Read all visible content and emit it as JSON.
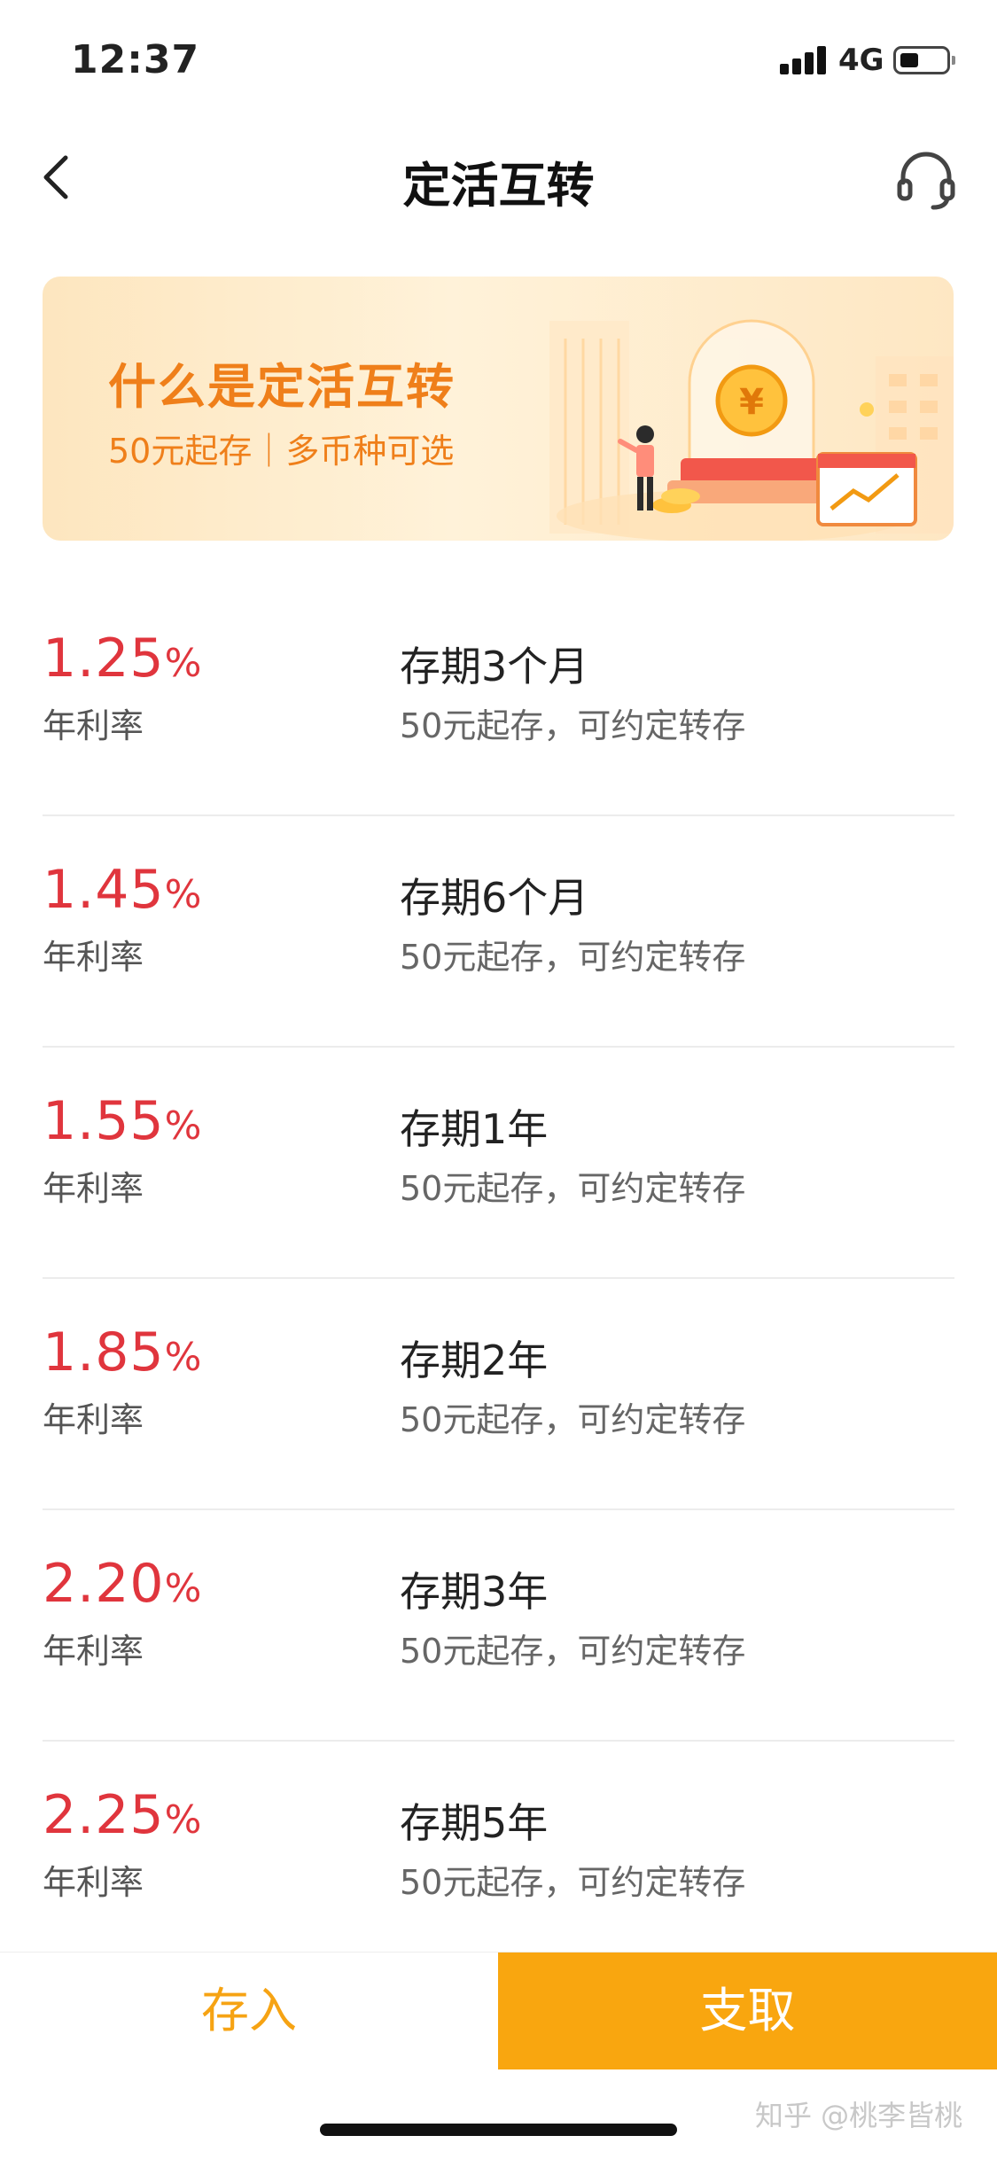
{
  "status_bar": {
    "time": "12:37",
    "network": "4G"
  },
  "nav": {
    "title": "定活互转",
    "back_icon": "chevron-left-icon",
    "support_icon": "headset-icon"
  },
  "banner": {
    "title": "什么是定活互转",
    "subtitle": "50元起存｜多币种可选"
  },
  "rates": [
    {
      "rate": "1.25",
      "unit": "%",
      "label": "年利率",
      "term": "存期3个月",
      "desc": "50元起存，可约定转存"
    },
    {
      "rate": "1.45",
      "unit": "%",
      "label": "年利率",
      "term": "存期6个月",
      "desc": "50元起存，可约定转存"
    },
    {
      "rate": "1.55",
      "unit": "%",
      "label": "年利率",
      "term": "存期1年",
      "desc": "50元起存，可约定转存"
    },
    {
      "rate": "1.85",
      "unit": "%",
      "label": "年利率",
      "term": "存期2年",
      "desc": "50元起存，可约定转存"
    },
    {
      "rate": "2.20",
      "unit": "%",
      "label": "年利率",
      "term": "存期3年",
      "desc": "50元起存，可约定转存"
    },
    {
      "rate": "2.25",
      "unit": "%",
      "label": "年利率",
      "term": "存期5年",
      "desc": "50元起存，可约定转存"
    }
  ],
  "actions": {
    "deposit": "存入",
    "withdraw": "支取"
  },
  "watermark": "知乎 @桃李皆桃",
  "colors": {
    "rate_red": "#e0353d",
    "accent_orange": "#f9a60f",
    "banner_text": "#ef7f1a"
  }
}
